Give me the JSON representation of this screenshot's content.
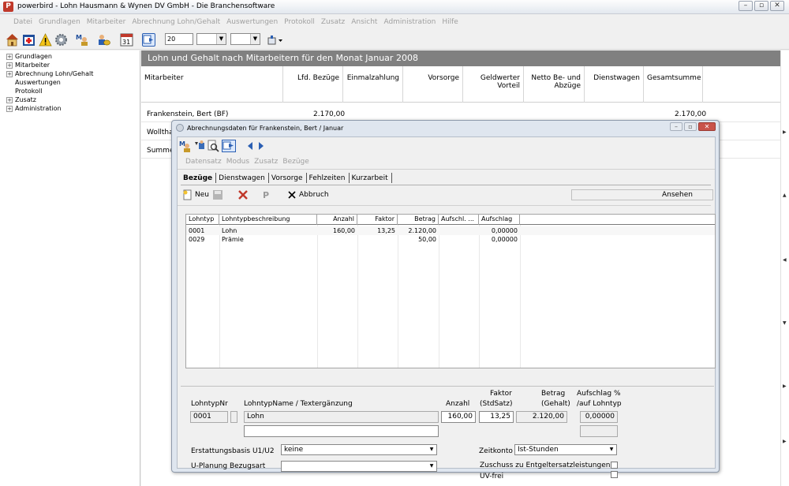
{
  "window": {
    "title": "powerbird - Lohn   Hausmann & Wynen DV GmbH - Die Branchensoftware",
    "app_icon_letter": "P"
  },
  "menu": [
    "Datei",
    "Grundlagen",
    "Mitarbeiter",
    "Abrechnung Lohn/Gehalt",
    "Auswertungen",
    "Protokoll",
    "Zusatz",
    "Ansicht",
    "Administration",
    "Hilfe"
  ],
  "toolbar": {
    "icons": [
      "home-icon",
      "calendar-plus-icon",
      "warning-icon",
      "gear-icon",
      "employee-icon",
      "people-money-icon",
      "calendar-31-icon",
      "export-icon"
    ],
    "calendar_day": "31",
    "combo1_value": "20",
    "combo2_value": "",
    "combo3_value": ""
  },
  "tree": [
    {
      "label": "Grundlagen",
      "expandable": true
    },
    {
      "label": "Mitarbeiter",
      "expandable": true
    },
    {
      "label": "Abrechnung Lohn/Gehalt",
      "expandable": true
    },
    {
      "label": "Auswertungen",
      "expandable": false
    },
    {
      "label": "Protokoll",
      "expandable": false
    },
    {
      "label": "Zusatz",
      "expandable": true
    },
    {
      "label": "Administration",
      "expandable": true
    }
  ],
  "main": {
    "header": "Lohn und Gehalt nach Mitarbeitern für den Monat Januar 2008",
    "columns": [
      "Mitarbeiter",
      "Lfd. Bezüge",
      "Einmalzahlung",
      "Vorsorge",
      "Geldwerter Vorteil",
      "Netto Be- und Abzüge",
      "Dienstwagen",
      "Gesamtsumme"
    ],
    "rows": [
      {
        "name": "Frankenstein, Bert (BF)",
        "lfd": "2.170,00",
        "total": "2.170,00"
      },
      {
        "name": "Wollthal",
        "lfd": "",
        "total": ""
      },
      {
        "name": "Summe",
        "lfd": "",
        "total": ""
      }
    ]
  },
  "dialog": {
    "title": "Abrechnungsdaten für Frankenstein, Bert / Januar",
    "menu": [
      "Datensatz",
      "Modus",
      "Zusatz",
      "Bezüge"
    ],
    "tabs": [
      "Bezüge",
      "Dienstwagen",
      "Vorsorge",
      "Fehlzeiten",
      "Kurzarbeit"
    ],
    "actions": {
      "new": "Neu",
      "save": "",
      "delete": "",
      "p": "P",
      "cancel": "Abbruch",
      "status": "Ansehen"
    },
    "grid": {
      "columns": [
        "Lohntyp",
        "Lohntypbeschreibung",
        "Anzahl",
        "Faktor",
        "Betrag",
        "Aufschl. ...",
        "Aufschlag"
      ],
      "rows": [
        {
          "typ": "0001",
          "desc": "Lohn",
          "anzahl": "160,00",
          "faktor": "13,25",
          "betrag": "2.120,00",
          "aufschl": "",
          "aufschlag": "0,00000"
        },
        {
          "typ": "0029",
          "desc": "Prämie",
          "anzahl": "",
          "faktor": "",
          "betrag": "50,00",
          "aufschl": "",
          "aufschlag": "0,00000"
        }
      ]
    },
    "detail": {
      "lohntypnr_label": "LohntypNr",
      "lohntypname_label": "LohntypName / Textergänzung",
      "anzahl_label": "Anzahl",
      "faktor_label_1": "Faktor",
      "faktor_label_2": "(StdSatz)",
      "betrag_label_1": "Betrag",
      "betrag_label_2": "(Gehalt)",
      "aufschlag_label_1": "Aufschlag %",
      "aufschlag_label_2": "/auf Lohntyp",
      "lohntypnr": "0001",
      "lohntypname": "Lohn",
      "textergaenzung": "",
      "anzahl": "160,00",
      "faktor": "13,25",
      "betrag": "2.120,00",
      "aufschlag": "0,00000",
      "aufschlag_typ": "",
      "erstattungsbasis_label": "Erstattungsbasis U1/U2",
      "erstattungsbasis": "keine",
      "uplanung_label": "U-Planung Bezugsart",
      "uplanung": "",
      "zeitkonto_label": "Zeitkonto",
      "zeitkonto": "Ist-Stunden",
      "zuschuss_label": "Zuschuss zu Entgeltersatzleistungen",
      "uvfrei_label": "UV-frei"
    }
  }
}
